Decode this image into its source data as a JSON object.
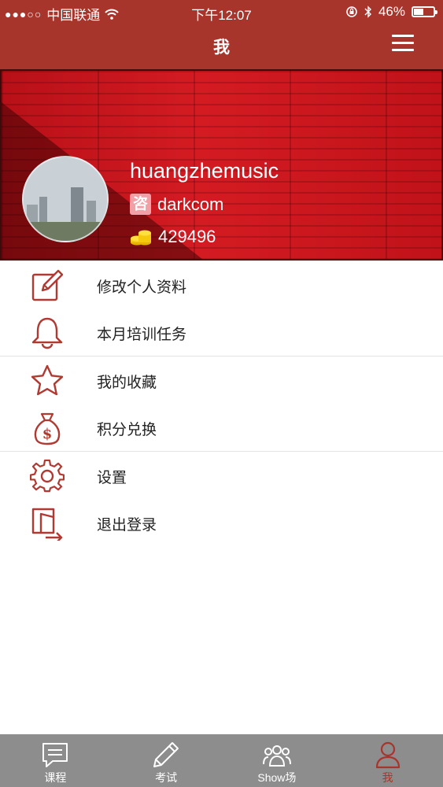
{
  "status_bar": {
    "signal": "●●●○○",
    "carrier": "中国联通",
    "time": "下午12:07",
    "battery": "46%",
    "battery_level": 0.46
  },
  "navbar": {
    "title": "我"
  },
  "profile": {
    "username": "huangzhemusic",
    "group_badge": "咨",
    "group": "darkcom",
    "points": "429496"
  },
  "menu": {
    "items": [
      {
        "label": "修改个人资料",
        "icon": "edit-icon"
      },
      {
        "label": "本月培训任务",
        "icon": "bell-icon"
      },
      {
        "label": "我的收藏",
        "icon": "star-icon"
      },
      {
        "label": "积分兑换",
        "icon": "money-bag-icon"
      },
      {
        "label": "设置",
        "icon": "gear-icon"
      },
      {
        "label": "退出登录",
        "icon": "logout-icon"
      }
    ]
  },
  "tabbar": {
    "tabs": [
      {
        "label": "课程",
        "icon": "message-icon"
      },
      {
        "label": "考试",
        "icon": "pencil-icon"
      },
      {
        "label": "Show场",
        "icon": "group-icon"
      },
      {
        "label": "我",
        "icon": "person-icon",
        "active": true
      }
    ]
  },
  "colors": {
    "accent": "#a8352c",
    "banner": "#c4141b",
    "tabbar": "#8d8d8d",
    "icon": "#b03a32"
  }
}
